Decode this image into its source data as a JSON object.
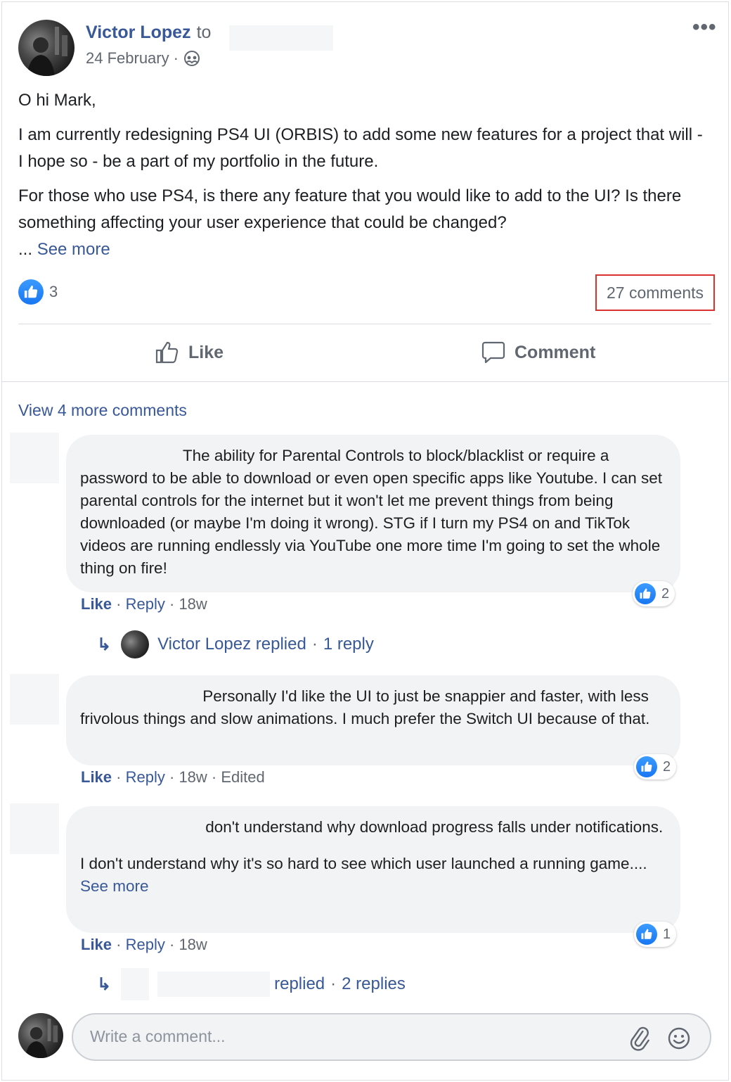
{
  "post": {
    "author": "Victor Lopez",
    "to_word": "to",
    "date": "24 February",
    "date_separator": "·",
    "more_icon": "more-dots-icon",
    "privacy_icon": "friends-icon",
    "paragraphs": [
      "O hi Mark,",
      "I am currently redesigning PS4 UI (ORBIS) to add some new features for a project that will - I hope so - be a part of my portfolio in the future.",
      "For those who use PS4, is there any feature that you would like to add to the UI? Is there something affecting your user experience that could be changed?"
    ],
    "ellipsis": "...",
    "see_more": "See more",
    "reaction_count": "3",
    "comments_count": "27 comments",
    "actions": {
      "like": "Like",
      "comment": "Comment"
    }
  },
  "comments_section": {
    "view_more": "View 4 more comments",
    "comments": [
      {
        "text": "The ability for Parental Controls to block/blacklist or require a password to be able to download or even open specific apps like Youtube. I can set parental controls for the internet but it won't let me prevent things from being downloaded (or maybe I'm doing it wrong). STG if I turn my PS4 on and TikTok videos are running endlessly via YouTube one more time I'm going to set the whole thing on fire!",
        "like": "Like",
        "reply": "Reply",
        "time": "18w",
        "reactions": "2",
        "replies": {
          "author": "Victor Lopez",
          "replied": "replied",
          "count": "1 reply"
        }
      },
      {
        "text": "Personally I'd like the UI to just be snappier and faster, with less frivolous things and slow animations. I much prefer the Switch UI because of that.",
        "like": "Like",
        "reply": "Reply",
        "time": "18w",
        "edited": "Edited",
        "reactions": "2"
      },
      {
        "text1": "don't understand why download progress falls under notifications.",
        "text2": "I don't understand why it's so hard to see which user launched a running game.",
        "ellipsis": "...",
        "see_more": "See more",
        "like": "Like",
        "reply": "Reply",
        "time": "18w",
        "reactions": "1",
        "replies": {
          "replied": "replied",
          "count": "2 replies"
        }
      }
    ],
    "meta_separator": "·",
    "write_placeholder": "Write a comment..."
  },
  "colors": {
    "link": "#385898",
    "secondary_text": "#606770",
    "bubble": "#f2f3f5",
    "like_blue": "#1877f2",
    "highlight_box": "#d93030"
  }
}
